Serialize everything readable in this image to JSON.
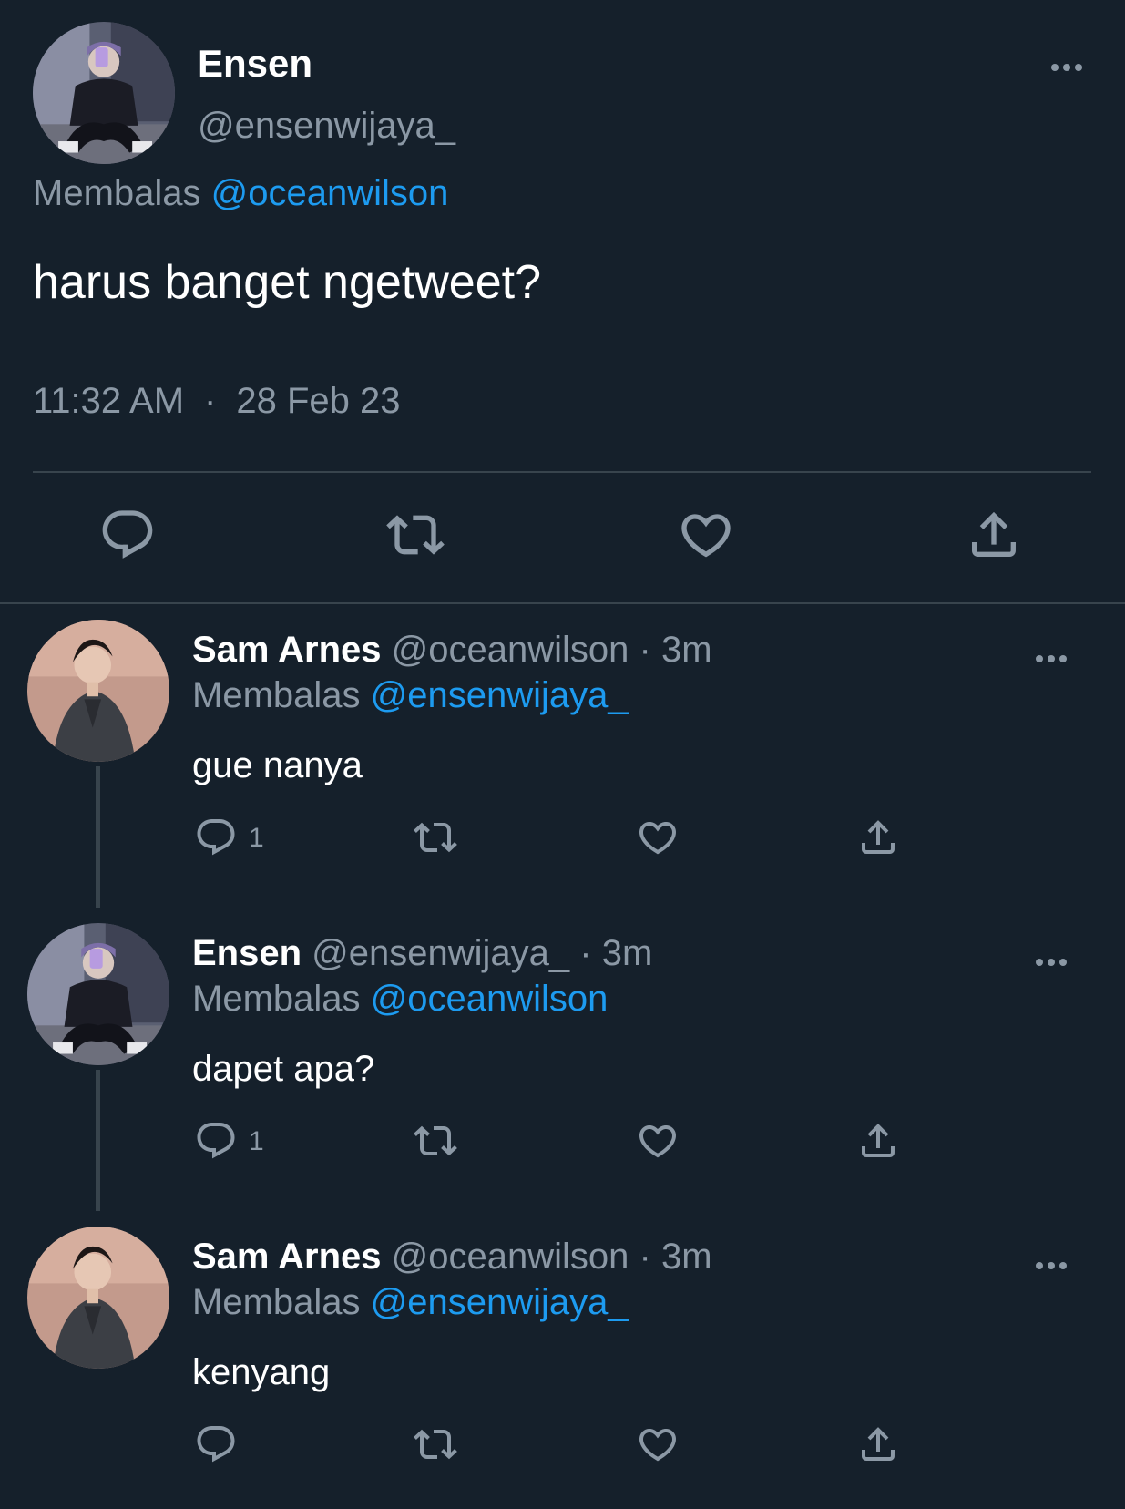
{
  "main_tweet": {
    "name": "Ensen",
    "handle": "@ensenwijaya_",
    "replying_prefix": "Membalas",
    "replying_to": "@oceanwilson",
    "text": "harus banget ngetweet?",
    "time": "11:32 AM",
    "separator": "·",
    "date": "28 Feb 23",
    "icons": [
      "more-icon",
      "reply-icon",
      "retweet-icon",
      "like-icon",
      "share-icon"
    ]
  },
  "replies": [
    {
      "name": "Sam Arnes",
      "handle": "@oceanwilson",
      "time_sep": "·",
      "time": "3m",
      "replying_prefix": "Membalas",
      "replying_to": "@ensenwijaya_",
      "text": "gue nanya",
      "reply_count": "1"
    },
    {
      "name": "Ensen",
      "handle": "@ensenwijaya_",
      "time_sep": "·",
      "time": "3m",
      "replying_prefix": "Membalas",
      "replying_to": "@oceanwilson",
      "text": "dapet apa?",
      "reply_count": "1"
    },
    {
      "name": "Sam Arnes",
      "handle": "@oceanwilson",
      "time_sep": "·",
      "time": "3m",
      "replying_prefix": "Membalas",
      "replying_to": "@ensenwijaya_",
      "text": "kenyang",
      "reply_count": ""
    }
  ],
  "colors": {
    "background": "#15202b",
    "text_primary": "#ffffff",
    "text_secondary": "#8b98a5",
    "accent": "#1d9bf0",
    "divider": "#38444d"
  }
}
